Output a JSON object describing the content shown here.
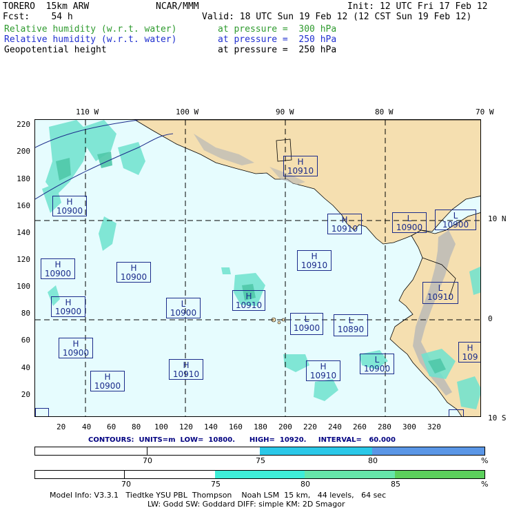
{
  "header": {
    "model": "TORERO  15km ARW",
    "org": "NCAR/MMM",
    "init": "Init: 12 UTC Fri 17 Feb 12",
    "fcst": "Fcst:    54 h",
    "valid": "Valid: 18 UTC Sun 19 Feb 12 (12 CST Sun 19 Feb 12)",
    "fields": [
      {
        "name": "Relative humidity (w.r.t. water)",
        "level": "at pressure =  300 hPa",
        "color": "#2e9a2e"
      },
      {
        "name": "Relative humidity (w.r.t. water)",
        "level": "at pressure =  250 hPa",
        "color": "#1f2fcf"
      },
      {
        "name": "Geopotential height",
        "level": "at pressure =  250 hPa",
        "color": "#000000"
      }
    ]
  },
  "map": {
    "lon_labels": [
      "110 W",
      "100 W",
      "90 W",
      "80 W",
      "70 W"
    ],
    "lat_labels": [
      "10 N",
      "0",
      "10 S"
    ],
    "x_ticks": [
      "20",
      "40",
      "60",
      "80",
      "100",
      "120",
      "140",
      "160",
      "180",
      "200",
      "220",
      "240",
      "260",
      "280",
      "300",
      "320"
    ],
    "y_ticks": [
      "220",
      "200",
      "180",
      "160",
      "140",
      "120",
      "100",
      "80",
      "60",
      "40",
      "20"
    ],
    "colors": {
      "ocean": "#e6fcfe",
      "land": "#f5dfb0",
      "mountain": "#b9b9b9",
      "rh_light": "#6fe3cf",
      "rh_mid": "#4fc8a8",
      "box": "#1a2a8a"
    },
    "centers": [
      {
        "type": "H",
        "value": "10910"
      },
      {
        "type": "H",
        "value": "10900"
      },
      {
        "type": "H",
        "value": "10910"
      },
      {
        "type": "L",
        "value": "10900"
      },
      {
        "type": "L",
        "value": "10900"
      },
      {
        "type": "H",
        "value": "10910"
      },
      {
        "type": "H",
        "value": "10900"
      },
      {
        "type": "H",
        "value": "10900"
      },
      {
        "type": "H",
        "value": "10900"
      },
      {
        "type": "L",
        "value": "10900"
      },
      {
        "type": "H",
        "value": "10910"
      },
      {
        "type": "L",
        "value": "10910"
      },
      {
        "type": "L",
        "value": "10900"
      },
      {
        "type": "L",
        "value": "10890"
      },
      {
        "type": "H",
        "value": "10900"
      },
      {
        "type": "H",
        "value": "10910"
      },
      {
        "type": "H",
        "value": "10910"
      },
      {
        "type": "L",
        "value": "10900"
      },
      {
        "type": "H",
        "value": "10900"
      },
      {
        "type": "H",
        "value": "109"
      }
    ]
  },
  "contours": "CONTOURS:  UNITS=m  LOW=  10800.      HIGH=  10920.     INTERVAL=   60.000",
  "legend1": {
    "labels": [
      "70",
      "75",
      "80"
    ],
    "unit": "%",
    "colors": [
      "#ffffff",
      "#2ac8e8",
      "#5a96e6"
    ]
  },
  "legend2": {
    "labels": [
      "70",
      "75",
      "80",
      "85"
    ],
    "unit": "%",
    "colors": [
      "#ffffff",
      "#3eeed8",
      "#66e6aa",
      "#5cd05c"
    ]
  },
  "footer": {
    "line1": "Model Info: V3.3.1   Tiedtke YSU PBL  Thompson    Noah LSM  15 km,   44 levels,   64 sec",
    "line2": "LW: Godd SW: Goddard DIFF: simple KM: 2D Smagor"
  }
}
